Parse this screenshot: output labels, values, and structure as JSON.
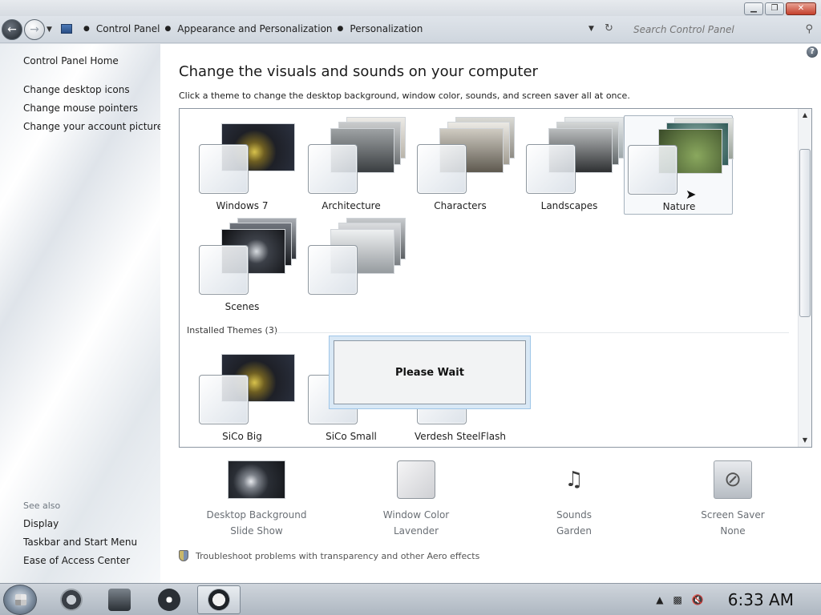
{
  "window": {
    "minimize_glyph": "▁",
    "maximize_glyph": "❐",
    "close_glyph": "✕"
  },
  "address": {
    "breadcrumbs": [
      "Control Panel",
      "Appearance and Personalization",
      "Personalization"
    ],
    "search_placeholder": "Search Control Panel"
  },
  "sidebar": {
    "home": "Control Panel Home",
    "links": [
      "Change desktop icons",
      "Change mouse pointers",
      "Change your account picture"
    ],
    "see_also_label": "See also",
    "see_also": [
      "Display",
      "Taskbar and Start Menu",
      "Ease of Access Center"
    ]
  },
  "main": {
    "title": "Change the visuals and sounds on your computer",
    "subtitle": "Click a theme to change the desktop background, window color, sounds, and screen saver all at once.",
    "help_glyph": "?",
    "aero_themes": [
      "Windows 7",
      "Architecture",
      "Characters",
      "Landscapes",
      "Nature",
      "Scenes",
      ""
    ],
    "selected_theme": "Nature",
    "installed_label": "Installed Themes (3)",
    "installed_themes": [
      "SiCo Big",
      "SiCo Small",
      "Verdesh SteelFlash"
    ],
    "dialog_text": "Please Wait"
  },
  "bottom": {
    "items": [
      {
        "label": "Desktop Background",
        "value": "Slide Show"
      },
      {
        "label": "Window Color",
        "value": "Lavender"
      },
      {
        "label": "Sounds",
        "value": "Garden"
      },
      {
        "label": "Screen Saver",
        "value": "None"
      }
    ],
    "troubleshoot": "Troubleshoot problems with transparency and other Aero effects"
  },
  "taskbar": {
    "clock": "6:33 AM"
  },
  "colors": {
    "accent_blue": "#9fc6e8",
    "window_color_lavender": "#d6d7db"
  }
}
